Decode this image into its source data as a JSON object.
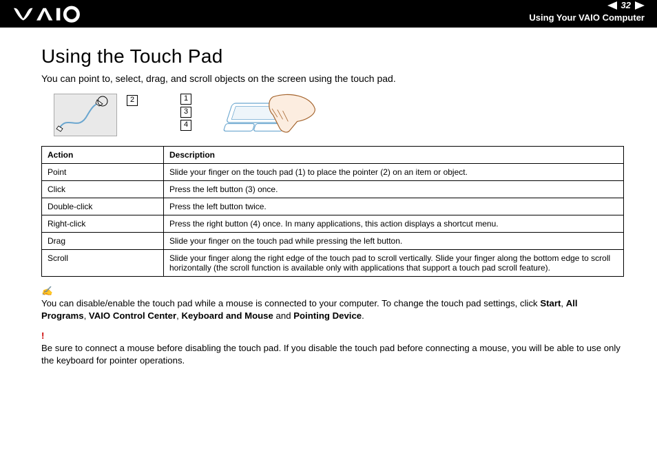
{
  "header": {
    "page_number": "32",
    "subtitle": "Using Your VAIO Computer"
  },
  "title": "Using the Touch Pad",
  "intro": "You can point to, select, drag, and scroll objects on the screen using the touch pad.",
  "diagram": {
    "labels": {
      "one": "1",
      "two": "2",
      "three": "3",
      "four": "4"
    }
  },
  "table": {
    "headers": {
      "action": "Action",
      "description": "Description"
    },
    "rows": [
      {
        "action": "Point",
        "description": "Slide your finger on the touch pad (1) to place the pointer (2) on an item or object."
      },
      {
        "action": "Click",
        "description": "Press the left button (3) once."
      },
      {
        "action": "Double-click",
        "description": "Press the left button twice."
      },
      {
        "action": "Right-click",
        "description": "Press the right button (4) once. In many applications, this action displays a shortcut menu."
      },
      {
        "action": "Drag",
        "description": "Slide your finger on the touch pad while pressing the left button."
      },
      {
        "action": "Scroll",
        "description": "Slide your finger along the right edge of the touch pad to scroll vertically. Slide your finger along the bottom edge to scroll horizontally (the scroll function is available only with applications that support a touch pad scroll feature)."
      }
    ]
  },
  "note": {
    "part1": "You can disable/enable the touch pad while a mouse is connected to your computer. To change the touch pad settings, click ",
    "b1": "Start",
    "c1": ", ",
    "b2": "All Programs",
    "c2": ", ",
    "b3": "VAIO Control Center",
    "c3": ", ",
    "b4": "Keyboard and Mouse",
    "c4": " and ",
    "b5": "Pointing Device",
    "c5": "."
  },
  "warning": {
    "mark": "!",
    "text": "Be sure to connect a mouse before disabling the touch pad. If you disable the touch pad before connecting a mouse, you will be able to use only the keyboard for pointer operations."
  }
}
